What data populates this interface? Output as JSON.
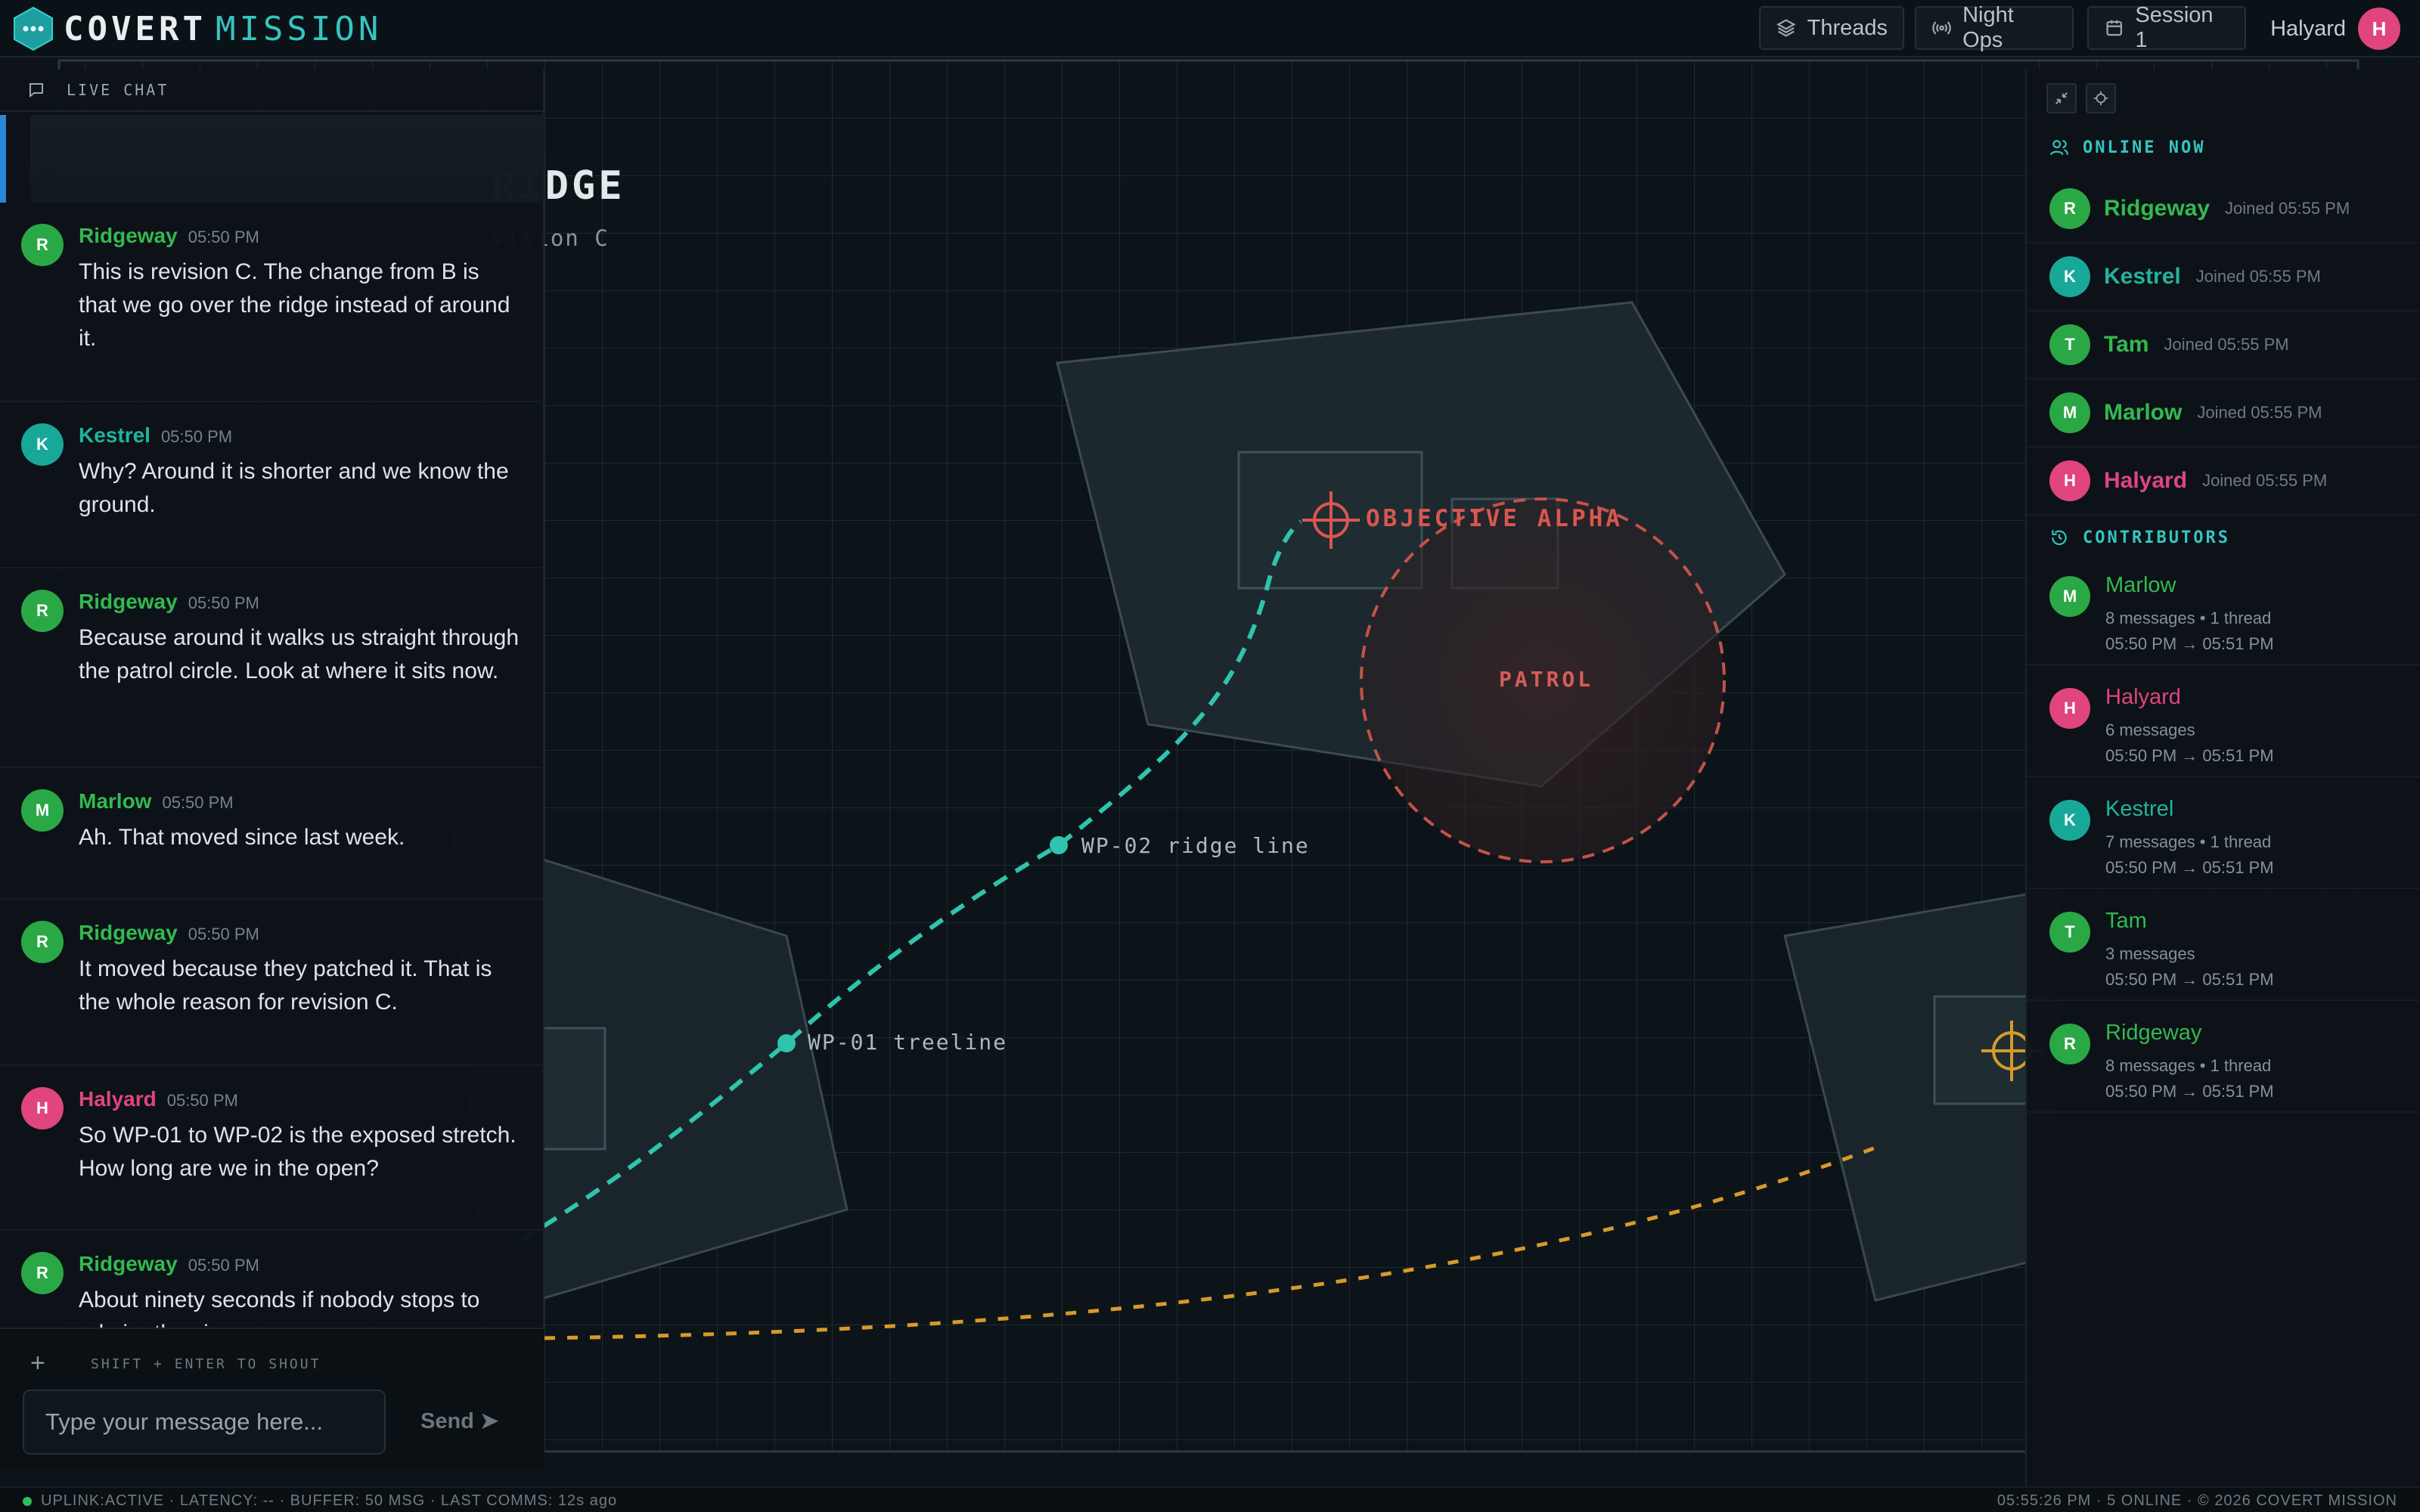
{
  "header": {
    "brand_primary": "COVERT",
    "brand_secondary": "MISSION",
    "threads_label": "Threads",
    "channel_label": "Night Ops",
    "session_label": "Session 1",
    "user_name": "Halyard",
    "user_initial": "H"
  },
  "map": {
    "title": "RIDGE",
    "subtitle": "vision C",
    "objective_label": "OBJECTIVE ALPHA",
    "patrol_label": "PATROL",
    "waypoints": [
      {
        "label": "WP-01 treeline"
      },
      {
        "label": "WP-02 ridge line"
      }
    ]
  },
  "chat": {
    "header": "LIVE CHAT",
    "messages": [
      {
        "author": "Ridgeway",
        "initial": "R",
        "time": "05:50 PM",
        "text": "This is revision C. The change from B is that we go over the ridge instead of around it."
      },
      {
        "author": "Kestrel",
        "initial": "K",
        "time": "05:50 PM",
        "text": "Why? Around it is shorter and we know the ground."
      },
      {
        "author": "Ridgeway",
        "initial": "R",
        "time": "05:50 PM",
        "text": "Because around it walks us straight through the patrol circle. Look at where it sits now."
      },
      {
        "author": "Marlow",
        "initial": "M",
        "time": "05:50 PM",
        "text": "Ah. That moved since last week."
      },
      {
        "author": "Ridgeway",
        "initial": "R",
        "time": "05:50 PM",
        "text": "It moved because they patched it. That is the whole reason for revision C."
      },
      {
        "author": "Halyard",
        "initial": "H",
        "time": "05:50 PM",
        "text": "So WP-01 to WP-02 is the exposed stretch. How long are we in the open?"
      },
      {
        "author": "Ridgeway",
        "initial": "R",
        "time": "05:50 PM",
        "text": "About ninety seconds if nobody stops to admire the view."
      }
    ],
    "composer_hint": "SHIFT + ENTER TO SHOUT",
    "composer_placeholder": "Type your message here...",
    "send_label": "Send ➤"
  },
  "online": {
    "header": "ONLINE NOW",
    "users": [
      {
        "name": "Ridgeway",
        "initial": "R",
        "joined": "Joined 05:55 PM"
      },
      {
        "name": "Kestrel",
        "initial": "K",
        "joined": "Joined 05:55 PM"
      },
      {
        "name": "Tam",
        "initial": "T",
        "joined": "Joined 05:55 PM"
      },
      {
        "name": "Marlow",
        "initial": "M",
        "joined": "Joined 05:55 PM"
      },
      {
        "name": "Halyard",
        "initial": "H",
        "joined": "Joined 05:55 PM"
      }
    ]
  },
  "contributors": {
    "header": "CONTRIBUTORS",
    "list": [
      {
        "name": "Marlow",
        "initial": "M",
        "stats": "8 messages • 1 thread",
        "range": "05:50 PM → 05:51 PM"
      },
      {
        "name": "Halyard",
        "initial": "H",
        "stats": "6 messages",
        "range": "05:50 PM → 05:51 PM"
      },
      {
        "name": "Kestrel",
        "initial": "K",
        "stats": "7 messages • 1 thread",
        "range": "05:50 PM → 05:51 PM"
      },
      {
        "name": "Tam",
        "initial": "T",
        "stats": "3 messages",
        "range": "05:50 PM → 05:51 PM"
      },
      {
        "name": "Ridgeway",
        "initial": "R",
        "stats": "8 messages • 1 thread",
        "range": "05:50 PM → 05:51 PM"
      }
    ]
  },
  "status": {
    "left": "UPLINK:ACTIVE · LATENCY: -- · BUFFER: 50 MSG · LAST COMMS: 12s ago",
    "right": "05:55:26 PM · 5 ONLINE · © 2026 COVERT MISSION"
  },
  "colors": {
    "green": "#2aa845",
    "teal": "#18a898",
    "pink": "#e0457d",
    "accent": "#35c5c0",
    "objective": "#d9574f",
    "route_primary": "#2fc4ad",
    "route_secondary": "#d79a2a"
  }
}
